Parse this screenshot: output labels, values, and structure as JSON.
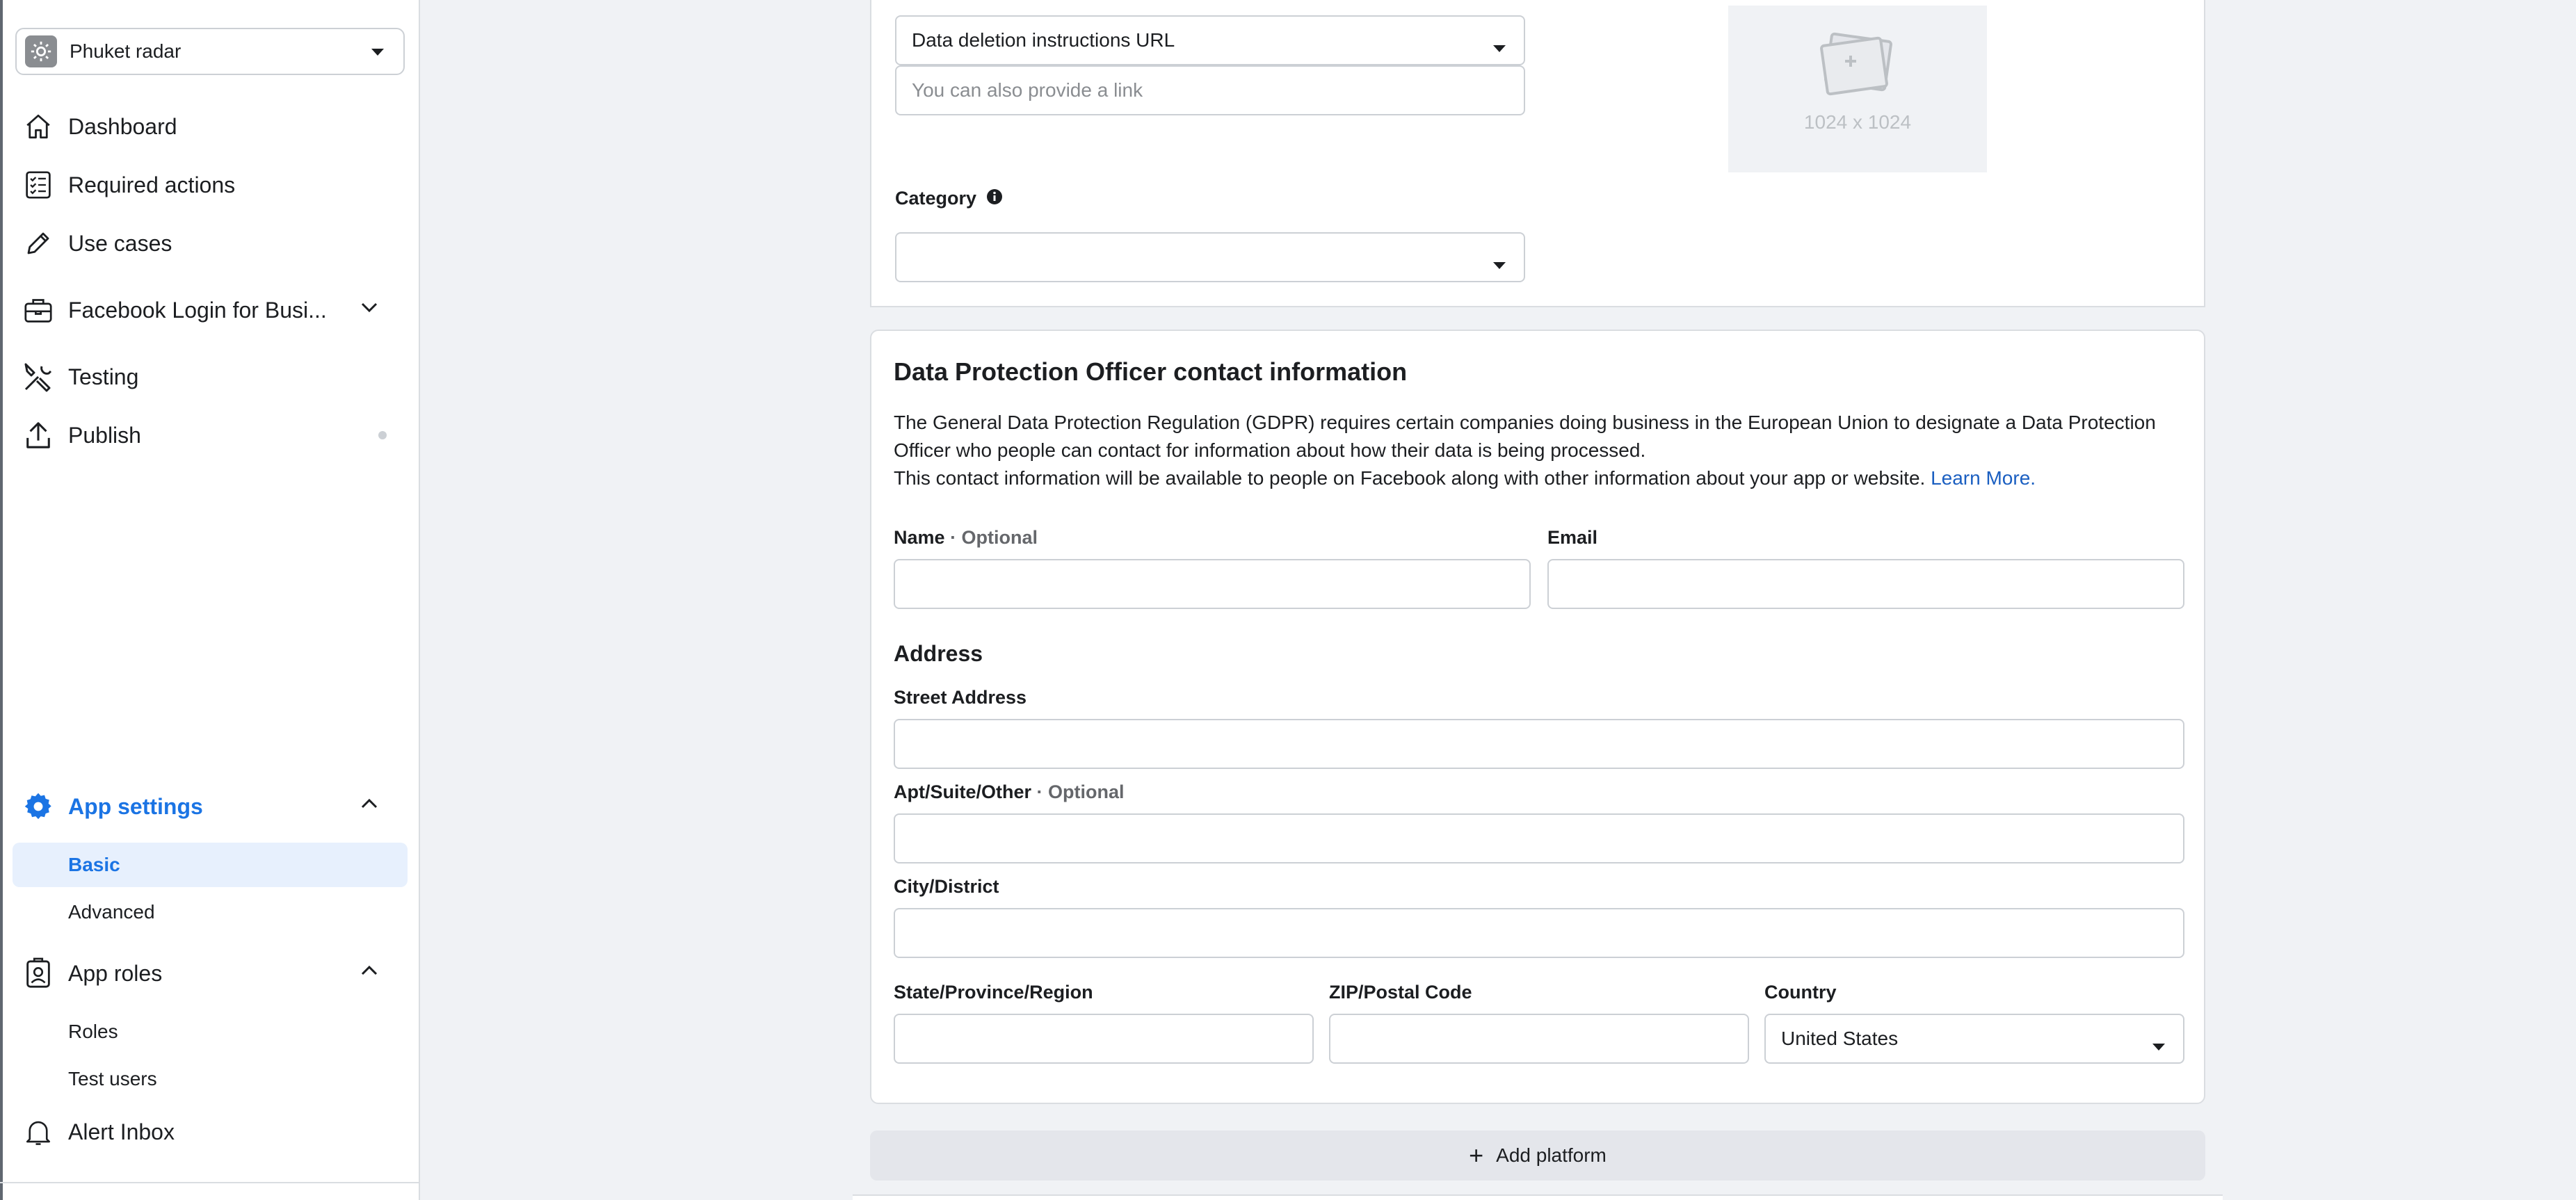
{
  "sidebar": {
    "app_name": "Phuket radar",
    "items": [
      {
        "label": "Dashboard",
        "icon": "home-icon"
      },
      {
        "label": "Required actions",
        "icon": "checklist-icon"
      },
      {
        "label": "Use cases",
        "icon": "pencil-icon"
      },
      {
        "label": "Facebook Login for Busi...",
        "icon": "briefcase-icon"
      },
      {
        "label": "Testing",
        "icon": "tools-icon"
      },
      {
        "label": "Publish",
        "icon": "upload-icon"
      }
    ],
    "app_settings": {
      "label": "App settings",
      "sub": [
        "Basic",
        "Advanced"
      ]
    },
    "app_roles": {
      "label": "App roles",
      "sub": [
        "Roles",
        "Test users"
      ]
    },
    "alert_inbox": "Alert Inbox"
  },
  "top_card": {
    "deletion_select": "Data deletion instructions URL",
    "link_placeholder": "You can also provide a link",
    "image_dim": "1024 x 1024",
    "category_label": "Category",
    "category_value": ""
  },
  "dpo": {
    "title": "Data Protection Officer contact information",
    "desc_1": "The General Data Protection Regulation (GDPR) requires certain companies doing business in the European Union to designate a Data Protection Officer who people can contact for information about how their data is being processed.",
    "desc_2": "This contact information will be available to people on Facebook along with other information about your app or website.",
    "learn_more": "Learn More.",
    "name_label": "Name",
    "optional": "· Optional",
    "email_label": "Email",
    "address_heading": "Address",
    "street_label": "Street Address",
    "apt_label": "Apt/Suite/Other",
    "city_label": "City/District",
    "state_label": "State/Province/Region",
    "zip_label": "ZIP/Postal Code",
    "country_label": "Country",
    "country_value": "United States"
  },
  "add_platform": "Add platform",
  "colors": {
    "accent": "#1b74e4",
    "link": "#1b5fc1",
    "border": "#ccd0d5",
    "page_bg": "#f0f2f5"
  }
}
